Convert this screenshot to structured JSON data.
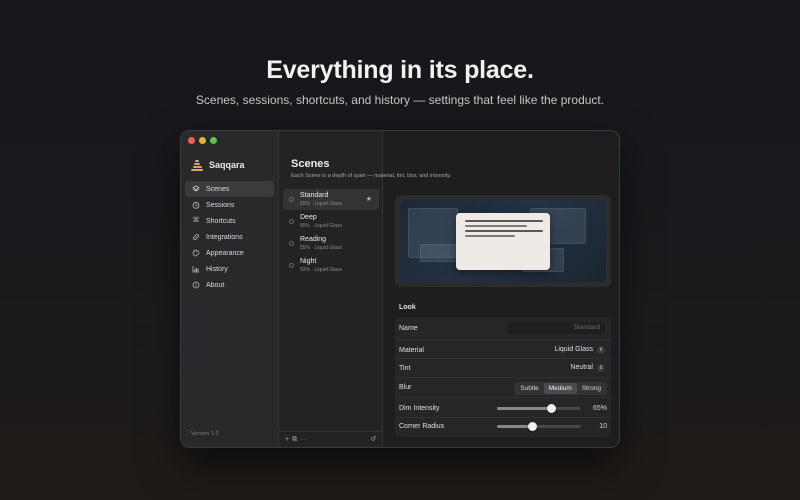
{
  "hero": {
    "title": "Everything in its place.",
    "subtitle": "Scenes, sessions, shortcuts, and history — settings that feel like the product."
  },
  "app": {
    "name": "Saqqara",
    "version": "Version 1.0",
    "accent": "#d6a768"
  },
  "sidebar": {
    "items": [
      {
        "label": "Scenes",
        "icon": "layers-icon",
        "active": true
      },
      {
        "label": "Sessions",
        "icon": "timer-icon",
        "active": false
      },
      {
        "label": "Shortcuts",
        "icon": "command-icon",
        "active": false
      },
      {
        "label": "Integrations",
        "icon": "link-icon",
        "active": false
      },
      {
        "label": "Appearance",
        "icon": "palette-icon",
        "active": false
      },
      {
        "label": "History",
        "icon": "chart-icon",
        "active": false
      },
      {
        "label": "About",
        "icon": "info-icon",
        "active": false
      }
    ]
  },
  "main": {
    "title": "Scenes",
    "subtitle": "Each Scene is a depth of quiet — material, tint, blur, and intensity."
  },
  "scenes": [
    {
      "name": "Standard",
      "meta": "65% · Liquid Glass",
      "starred": true,
      "active": true
    },
    {
      "name": "Deep",
      "meta": "85% · Liquid Glass",
      "starred": false,
      "active": false
    },
    {
      "name": "Reading",
      "meta": "55% · Liquid Glass",
      "starred": false,
      "active": false
    },
    {
      "name": "Night",
      "meta": "92% · Liquid Glass",
      "starred": false,
      "active": false
    }
  ],
  "list_footer": {
    "add": "+",
    "duplicate": "⧉",
    "more": "···",
    "reset": "↺"
  },
  "look": {
    "section_title": "Look",
    "name_label": "Name",
    "name_placeholder": "Standard",
    "material_label": "Material",
    "material_value": "Liquid Glass",
    "tint_label": "Tint",
    "tint_value": "Neutral",
    "blur_label": "Blur",
    "blur_options": [
      "Subtle",
      "Medium",
      "Strong"
    ],
    "blur_selected": "Medium",
    "dim_label": "Dim Intensity",
    "dim_value": 65,
    "dim_display": "65%",
    "radius_label": "Corner Radius",
    "radius_value": 10,
    "radius_max": 24,
    "radius_display": "10"
  }
}
